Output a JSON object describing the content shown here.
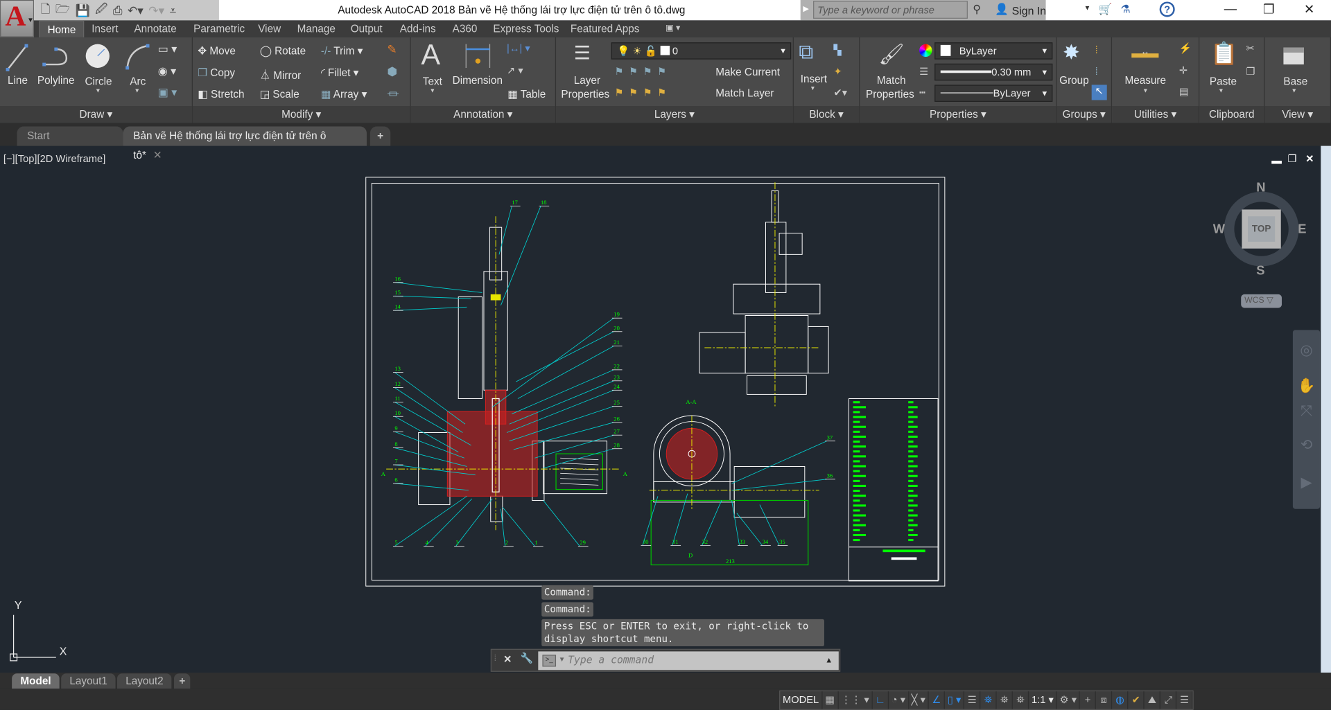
{
  "app": {
    "logo_letter": "A",
    "title": "Autodesk AutoCAD 2018    Bản vẽ Hệ thống lái trợ lực điện tử trên ô tô.dwg",
    "search_placeholder": "Type a keyword or phrase",
    "sign_in": "Sign In"
  },
  "ribbon_tabs": [
    "Home",
    "Insert",
    "Annotate",
    "Parametric",
    "View",
    "Manage",
    "Output",
    "Add-ins",
    "A360",
    "Express Tools",
    "Featured Apps"
  ],
  "panels": {
    "draw": {
      "title": "Draw ▾",
      "line": "Line",
      "polyline": "Polyline",
      "circle": "Circle",
      "arc": "Arc"
    },
    "modify": {
      "title": "Modify ▾",
      "move": "Move",
      "rotate": "Rotate",
      "trim": "Trim",
      "copy": "Copy",
      "mirror": "Mirror",
      "fillet": "Fillet",
      "stretch": "Stretch",
      "scale": "Scale",
      "array": "Array"
    },
    "annotation": {
      "title": "Annotation ▾",
      "text": "Text",
      "dimension": "Dimension",
      "table": "Table"
    },
    "layers": {
      "title": "Layers ▾",
      "layer_properties_1": "Layer",
      "layer_properties_2": "Properties",
      "current_layer": "0",
      "make_current": "Make Current",
      "match_layer": "Match Layer"
    },
    "block": {
      "title": "Block ▾",
      "insert": "Insert"
    },
    "properties": {
      "title": "Properties ▾",
      "match_1": "Match",
      "match_2": "Properties",
      "color": "ByLayer",
      "lineweight": "0.30 mm",
      "linetype": "ByLayer"
    },
    "groups": {
      "title": "Groups ▾",
      "group": "Group"
    },
    "utilities": {
      "title": "Utilities ▾",
      "measure": "Measure"
    },
    "clipboard": {
      "title": "Clipboard",
      "paste": "Paste"
    },
    "view": {
      "title": "View ▾",
      "base": "Base"
    }
  },
  "doc_tabs": {
    "start": "Start",
    "active": "Bản vẽ Hệ thống lái trợ lực điện tử trên ô tô*"
  },
  "viewport": {
    "label": "[−][Top][2D Wireframe]",
    "viewcube": {
      "n": "N",
      "s": "S",
      "e": "E",
      "w": "W",
      "face": "TOP",
      "wcs": "WCS"
    },
    "ucs": {
      "x": "X",
      "y": "Y"
    }
  },
  "drawing": {
    "labels": [
      "17",
      "18",
      "16",
      "15",
      "14",
      "13",
      "12",
      "11",
      "10",
      "9",
      "8",
      "7",
      "6",
      "5",
      "4",
      "3",
      "2",
      "1",
      "29",
      "19",
      "20",
      "21",
      "22",
      "23",
      "24",
      "25",
      "26",
      "27",
      "28",
      "30",
      "31",
      "32",
      "33",
      "34",
      "35",
      "37",
      "36"
    ],
    "section_title": "A-A",
    "section_mark": "A",
    "view_mark": "D",
    "dimension": "213",
    "colors": {
      "outline": "#ffffff",
      "hatch": "#d42020",
      "leader": "#00d0d0",
      "text": "#00ff00",
      "center": "#e6e600"
    }
  },
  "command": {
    "history": [
      "Command:",
      "Command:",
      "Press ESC or ENTER to exit, or right-click to display shortcut menu."
    ],
    "placeholder": "Type a command"
  },
  "layout_tabs": [
    "Model",
    "Layout1",
    "Layout2"
  ],
  "status": {
    "model": "MODEL",
    "scale": "1:1",
    "icons": [
      "grid-icon",
      "snap-icon",
      "ortho-icon",
      "polar-icon",
      "osnap-icon",
      "isodraft-icon",
      "otrack-icon",
      "lineweight-icon",
      "annotation-visibility-icon",
      "autoscale-icon",
      "workspace-gear-icon",
      "units-icon",
      "quick-properties-icon",
      "hardware-acceleration-icon",
      "isolate-icon",
      "clean-screen-icon",
      "customize-icon"
    ]
  }
}
